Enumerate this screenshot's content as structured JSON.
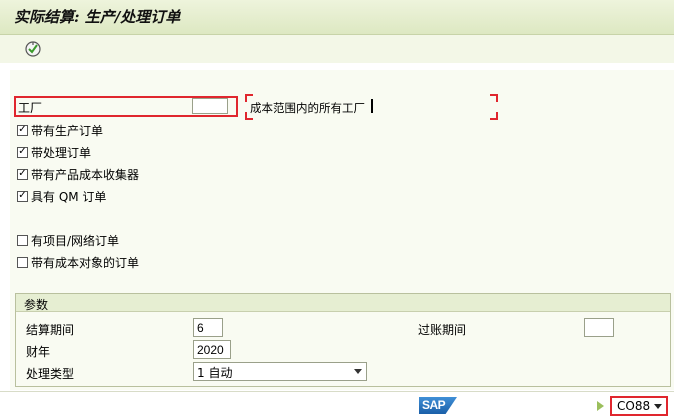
{
  "title": "实际结算: 生产/处理订单",
  "selection": {
    "plant_label": "工厂",
    "plant_value": "",
    "plant_description": "成本范围内的所有工厂"
  },
  "checkboxes": [
    {
      "label": "带有生产订单",
      "checked": true
    },
    {
      "label": "带处理订单",
      "checked": true
    },
    {
      "label": "带有产品成本收集器",
      "checked": true
    },
    {
      "label": "具有 QM 订单",
      "checked": true
    },
    {
      "label": "有项目/网络订单",
      "checked": false
    },
    {
      "label": "带有成本对象的订单",
      "checked": false
    }
  ],
  "parameters": {
    "title": "参数",
    "period_label": "结算期间",
    "period_value": "6",
    "posting_period_label": "过账期间",
    "posting_period_value": "",
    "fiscal_year_label": "财年",
    "fiscal_year_value": "2020",
    "processing_type_label": "处理类型",
    "processing_type_value": "1 自动"
  },
  "status": {
    "logo_text": "SAP",
    "tcode": "CO88"
  }
}
